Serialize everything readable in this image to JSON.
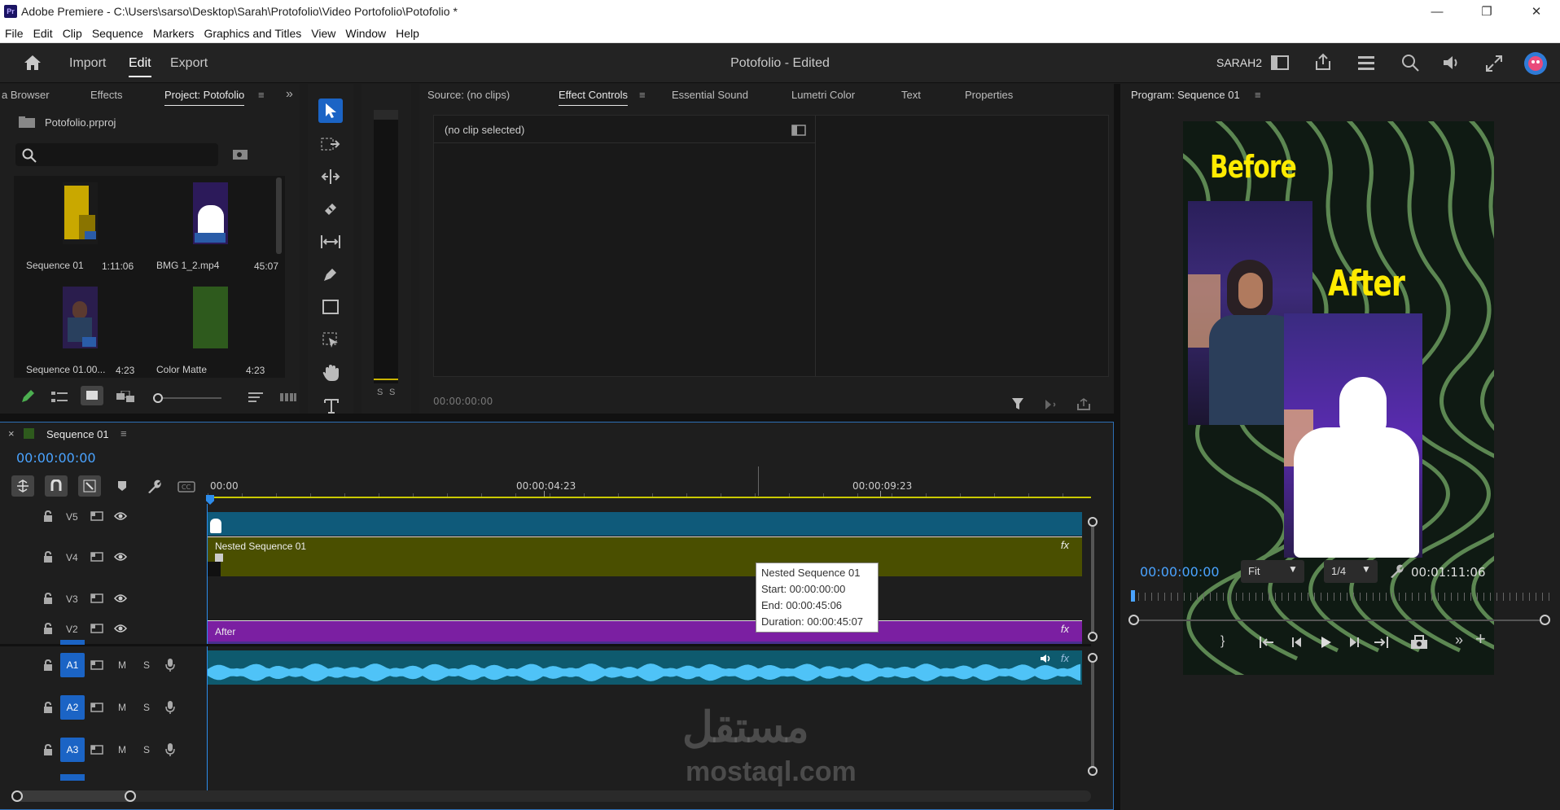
{
  "window": {
    "app_badge": "Pr",
    "title": "Adobe Premiere - C:\\Users\\sarso\\Desktop\\Sarah\\Protofolio\\Video Portofolio\\Potofolio *",
    "minimize": "—",
    "maximize": "❐",
    "close": "✕"
  },
  "menu": [
    "File",
    "Edit",
    "Clip",
    "Sequence",
    "Markers",
    "Graphics and Titles",
    "View",
    "Window",
    "Help"
  ],
  "appbar": {
    "workspaces": [
      "Import",
      "Edit",
      "Export"
    ],
    "active_workspace": "Edit",
    "document": "Potofolio - Edited",
    "user": "SARAH2"
  },
  "project_panel": {
    "tabs": [
      "a Browser",
      "Effects",
      "Project: Potofolio"
    ],
    "file": "Potofolio.prproj",
    "search_placeholder": "",
    "items": [
      {
        "name": "Sequence 01",
        "duration": "1:11:06"
      },
      {
        "name": "BMG 1_2.mp4",
        "duration": "45:07"
      },
      {
        "name": "Sequence 01.00...",
        "duration": "4:23"
      },
      {
        "name": "Color Matte",
        "duration": "4:23"
      }
    ],
    "colors": {
      "color_matte": "#2e5a1d"
    }
  },
  "source_panel": {
    "tabs": [
      "Source: (no clips)",
      "Effect Controls",
      "Essential Sound",
      "Lumetri Color",
      "Text",
      "Properties"
    ],
    "active_tab": "Effect Controls",
    "no_clip": "(no clip selected)",
    "timecode": "00:00:00:00"
  },
  "program_panel": {
    "title": "Program: Sequence 01",
    "text_before": "Before",
    "text_after": "After",
    "timecode": "00:00:00:00",
    "fit": "Fit",
    "resolution": "1/4",
    "duration": "00:01:11:06"
  },
  "meter": {
    "labels": [
      "S",
      "S"
    ]
  },
  "timeline": {
    "sequence": "Sequence 01",
    "timecode": "00:00:00:00",
    "ruler": [
      "00:00",
      "00:00:04:23",
      "00:00:09:23"
    ],
    "video_tracks": [
      "V5",
      "V4",
      "V3",
      "V2"
    ],
    "audio_tracks": [
      "A1",
      "A2",
      "A3"
    ],
    "audio_labels": {
      "mute": "M",
      "solo": "S"
    },
    "clips": {
      "v4": "Nested Sequence 01",
      "v2": "After",
      "fx": "fx"
    },
    "tooltip": {
      "name": "Nested Sequence 01",
      "start": "Start: 00:00:00:00",
      "end": "End: 00:00:45:06",
      "duration": "Duration: 00:00:45:07"
    },
    "colors": {
      "v5": "#0f5a7a",
      "v4": "#4a4f00",
      "v2": "#7b1fa2",
      "a1": "#0e5a6e",
      "wave": "#4fc3f7",
      "accent": "#2d8ceb"
    }
  },
  "watermark": {
    "arabic": "مستقل",
    "latin": "mostaql.com"
  }
}
